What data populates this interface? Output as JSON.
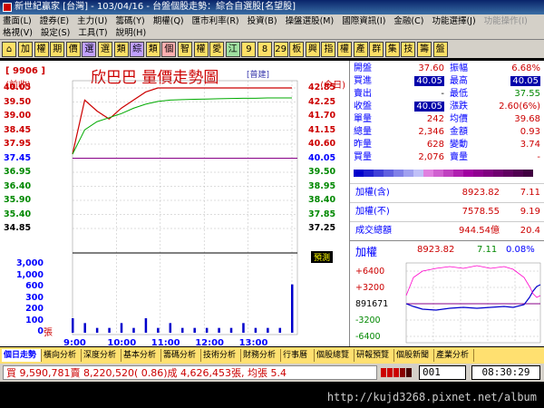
{
  "window": {
    "title": "新世紀贏家 [台灣] - 103/04/16 - 台盤個股走勢：綜合自選股[名望股]"
  },
  "menu": {
    "row1": [
      "畫面(L)",
      "證券(E)",
      "主力(U)",
      "籌碼(Y)",
      "期權(Q)",
      "匯市利率(R)",
      "投資(B)",
      "操盤選股(M)",
      "國際資訊(I)",
      "金融(C)",
      "功能選擇(J)"
    ],
    "row1_disabled": [
      "功能操作(I)"
    ],
    "row2": [
      "格視(V)",
      "設定(S)",
      "工具(T)",
      "說明(H)"
    ]
  },
  "iconbar": [
    "加",
    "權",
    "期",
    "價",
    "選",
    "選",
    "類",
    "綜",
    "類",
    "個",
    "智",
    "權",
    "愛",
    "江",
    "9",
    "8",
    "29",
    "板",
    "興",
    "指",
    "權",
    "產",
    "群",
    "集",
    "技",
    "籌",
    "盤"
  ],
  "chart": {
    "symbol": "[ 9906 ]",
    "prev_label": "(前收)",
    "today_label": "(今日)",
    "stock_name": "欣巴巴  量價走勢圖",
    "name_tag": "[普建]",
    "left_prices": [
      "40.05",
      "39.50",
      "39.00",
      "38.45",
      "37.95",
      "37.45",
      "36.95",
      "36.40",
      "35.90",
      "35.40",
      "34.85"
    ],
    "right_prices": [
      "42.85",
      "42.25",
      "41.70",
      "41.15",
      "40.60",
      "40.05",
      "39.50",
      "38.95",
      "38.40",
      "37.85",
      "37.25"
    ],
    "volume_labels": [
      "3,000",
      "1,000",
      "600",
      "300",
      "200",
      "100",
      "0"
    ],
    "volume_unit": "張",
    "time_labels": [
      "9:00",
      "10:00",
      "11:00",
      "12:00",
      "13:00"
    ],
    "badge": "預測"
  },
  "quote": {
    "rows": [
      {
        "l1": "開盤",
        "v1": "37.60",
        "l2": "振幅",
        "v2": "6.68%"
      },
      {
        "l1": "買進",
        "v1": "40.05",
        "l2": "最高",
        "v2": "40.05"
      },
      {
        "l1": "賣出",
        "v1": "-",
        "l2": "最低",
        "v2": "37.55"
      },
      {
        "l1": "收盤",
        "v1": "40.05",
        "l2": "漲跌",
        "v2": "2.60(6%)"
      },
      {
        "l1": "單量",
        "v1": "242",
        "l2": "均價",
        "v2": "39.68"
      },
      {
        "l1": "總量",
        "v1": "2,346",
        "l2": "金額",
        "v2": "0.93"
      },
      {
        "l1": "昨量",
        "v1": "628",
        "l2": "變動",
        "v2": "3.74"
      },
      {
        "l1": "買量",
        "v1": "2,076",
        "l2": "賣量",
        "v2": "-"
      }
    ],
    "index_rows": [
      {
        "label": "加權(含)",
        "value": "8923.82",
        "change": "7.11"
      },
      {
        "label": "加權(不)",
        "value": "7578.55",
        "change": "9.19"
      },
      {
        "label": "成交總額",
        "value": "944.54億",
        "change": "20.4"
      }
    ]
  },
  "mini": {
    "title": "加權",
    "value": "8923.82",
    "change": "7.11",
    "pct": "0.08%",
    "levels": [
      "+6400",
      "+3200",
      "891671",
      "-3200",
      "-6400"
    ]
  },
  "tabs": [
    "個日走勢",
    "橫向分析",
    "深度分析",
    "基本分析",
    "籌碼分析",
    "技術分析",
    "財務分析",
    "行事曆",
    "個股總覽",
    "研報預覽",
    "個股新聞",
    "產業分析"
  ],
  "status": {
    "ticker": "買 9,590,781賣 8,220,520( 0.86)成 4,626,453張, 均張 5.4",
    "code": "001",
    "time": "08:30:29"
  },
  "footer": {
    "url": "http://kujd3268.pixnet.net/album"
  },
  "chart_data": {
    "type": "line",
    "x": [
      "9:00",
      "9:15",
      "9:30",
      "9:45",
      "10:00",
      "10:15",
      "10:30",
      "10:45",
      "11:00",
      "11:15",
      "11:30",
      "11:45",
      "12:00",
      "12:15",
      "12:30",
      "12:45",
      "13:00",
      "13:15",
      "13:30"
    ],
    "series": [
      {
        "values": [
          37.6,
          39.6,
          39.2,
          38.9,
          39.3,
          39.6,
          39.9,
          40.05,
          40.05,
          40.05,
          40.05,
          40.05,
          40.05,
          40.05,
          40.05,
          40.05,
          40.05,
          40.05,
          40.05
        ]
      },
      {
        "values": [
          37.6,
          38.5,
          38.8,
          38.95,
          39.1,
          39.3,
          39.45,
          39.55,
          39.6,
          39.62,
          39.63,
          39.64,
          39.65,
          39.66,
          39.67,
          39.67,
          39.68,
          39.68,
          39.68
        ]
      }
    ],
    "volume": [
      60,
      40,
      20,
      20,
      40,
      20,
      60,
      20,
      40,
      20,
      20,
      20,
      20,
      20,
      40,
      20,
      20,
      20,
      200
    ],
    "ylim": [
      34.85,
      40.05
    ]
  }
}
